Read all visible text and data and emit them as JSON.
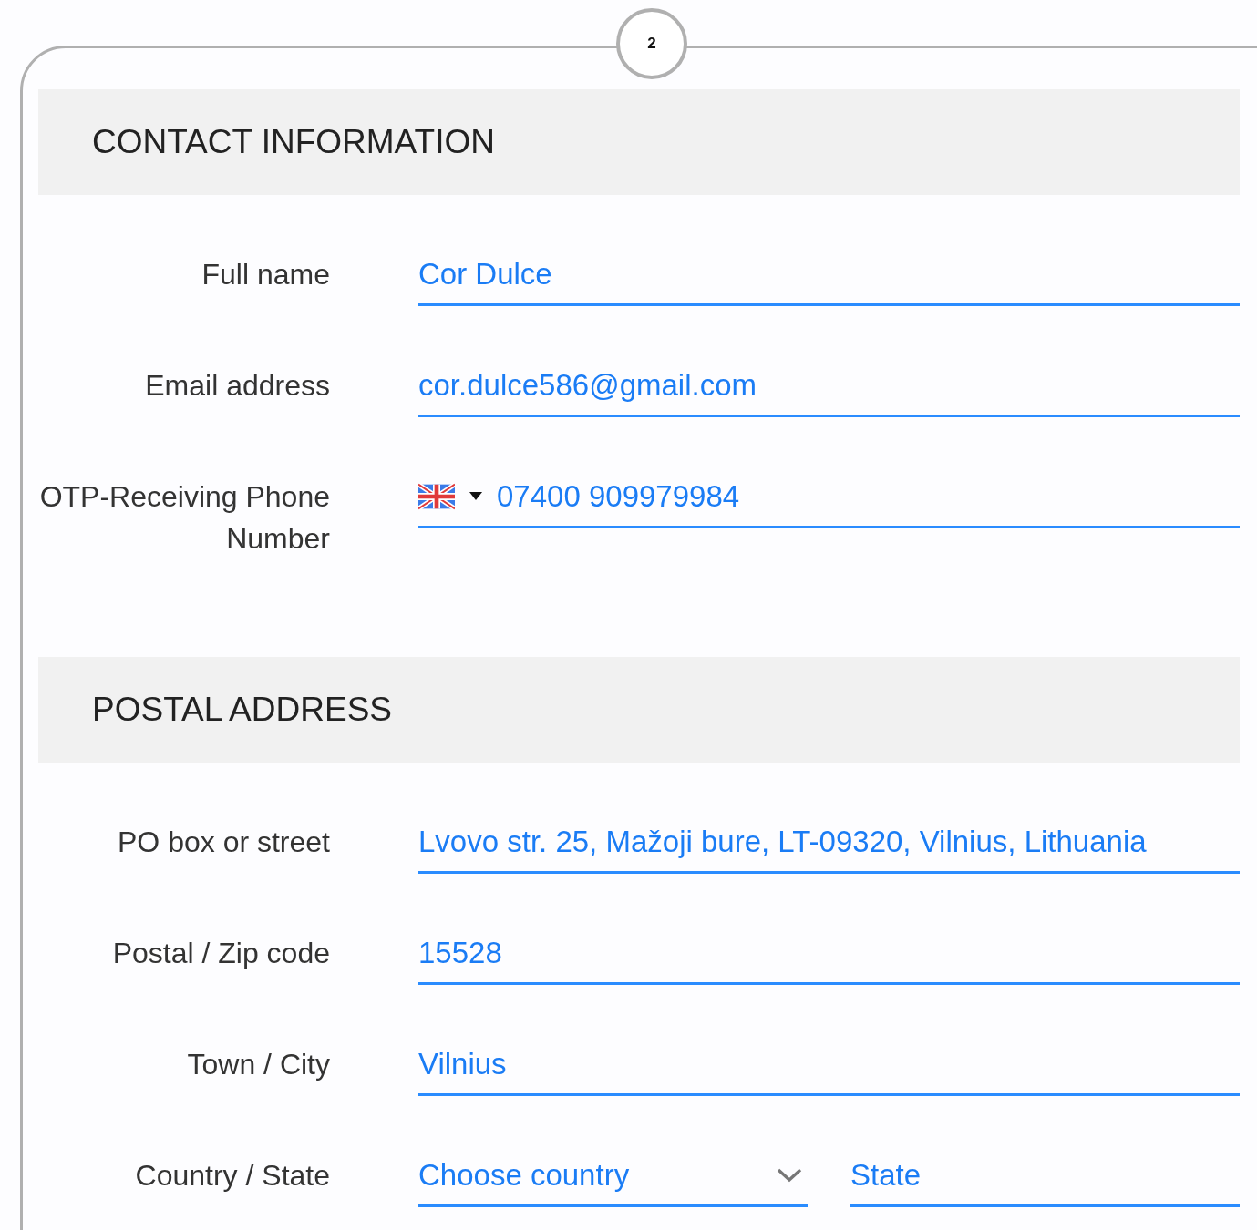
{
  "step_badge": "2",
  "sections": [
    {
      "title": "CONTACT INFORMATION",
      "fields": [
        {
          "kind": "text",
          "label": "Full name",
          "value": "Cor Dulce"
        },
        {
          "kind": "text",
          "label": "Email address",
          "value": "cor.dulce586@gmail.com"
        },
        {
          "kind": "phone",
          "label": "OTP-Receiving Phone Number",
          "value": "07400 909979984"
        }
      ]
    },
    {
      "title": "POSTAL ADDRESS",
      "fields": [
        {
          "kind": "text",
          "label": "PO box or street",
          "value": "Lvovo str. 25, Mažoji bure, LT-09320, Vilnius, Lithuania"
        },
        {
          "kind": "text",
          "label": "Postal / Zip code",
          "value": "15528"
        },
        {
          "kind": "text",
          "label": "Town / City",
          "value": "Vilnius"
        },
        {
          "kind": "country_state",
          "label": "Country / State",
          "country": "Choose country",
          "state": "State"
        }
      ]
    }
  ]
}
